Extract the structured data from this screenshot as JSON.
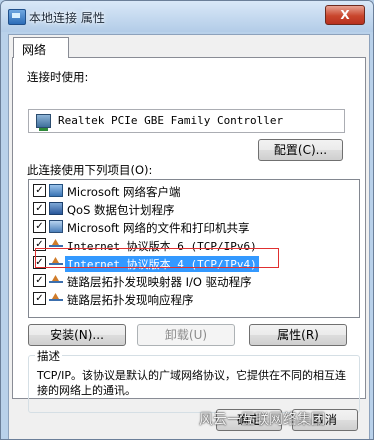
{
  "window": {
    "title": "本地连接 属性",
    "close_label": "X"
  },
  "tabs": [
    {
      "label": "网络",
      "selected": true
    }
  ],
  "connect_using": {
    "label": "连接时使用:",
    "adapter_name": "Realtek PCIe GBE Family Controller",
    "configure_button": "配置(C)..."
  },
  "items_section": {
    "label": "此连接使用下列项目(O):",
    "items": [
      {
        "label": "Microsoft 网络客户端",
        "checked": true,
        "icon": "network-client-icon"
      },
      {
        "label": "QoS 数据包计划程序",
        "checked": true,
        "icon": "qos-icon"
      },
      {
        "label": "Microsoft 网络的文件和打印机共享",
        "checked": true,
        "icon": "file-printer-share-icon"
      },
      {
        "label": "Internet 协议版本 6 (TCP/IPv6)",
        "checked": true,
        "icon": "protocol-icon"
      },
      {
        "label": "Internet 协议版本 4 (TCP/IPv4)",
        "checked": true,
        "icon": "protocol-icon",
        "selected": true
      },
      {
        "label": "链路层拓扑发现映射器 I/O 驱动程序",
        "checked": true,
        "icon": "protocol-icon"
      },
      {
        "label": "链路层拓扑发现响应程序",
        "checked": true,
        "icon": "protocol-icon"
      }
    ]
  },
  "buttons": {
    "install": "安装(N)...",
    "uninstall": "卸载(U)",
    "properties": "属性(R)",
    "ok": "确定",
    "cancel": "取消"
  },
  "description": {
    "title": "描述",
    "text": "TCP/IP。该协议是默认的广域网络协议，它提供在不同的相互连接的网络上的通讯。"
  },
  "watermark": "风云一互联网络集团"
}
